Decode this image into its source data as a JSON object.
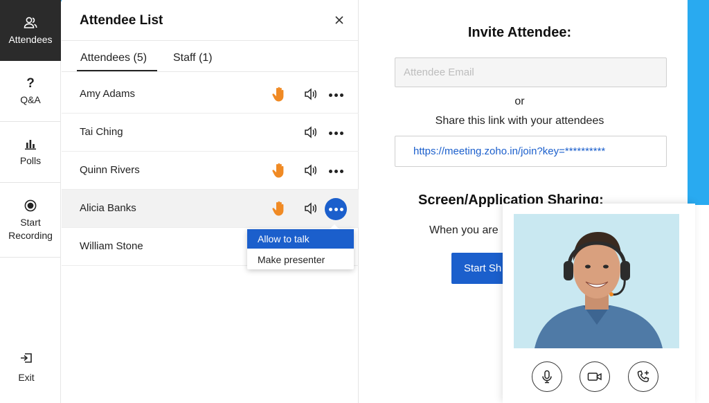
{
  "rail": {
    "items": [
      {
        "label": "Attendees",
        "icon": "people-icon",
        "active": true
      },
      {
        "label": "Q&A",
        "icon": "question-icon"
      },
      {
        "label": "Polls",
        "icon": "bar-chart-icon"
      },
      {
        "label": "Start Recording",
        "icon": "record-icon"
      }
    ],
    "exit_label": "Exit"
  },
  "attendee_panel": {
    "title": "Attendee List",
    "tabs": [
      {
        "label": "Attendees (5)",
        "active": true
      },
      {
        "label": "Staff (1)"
      }
    ],
    "rows": [
      {
        "name": "Amy Adams",
        "hand_raised": true
      },
      {
        "name": "Tai Ching",
        "hand_raised": false
      },
      {
        "name": "Quinn Rivers",
        "hand_raised": true
      },
      {
        "name": "Alicia Banks",
        "hand_raised": true,
        "menu_open": true
      },
      {
        "name": "William Stone",
        "hand_raised": false
      }
    ],
    "menu": {
      "items": [
        "Allow to talk",
        "Make presenter"
      ],
      "selected": "Allow to talk"
    }
  },
  "invite": {
    "title": "Invite Attendee:",
    "email_placeholder": "Attendee Email",
    "or_text": "or",
    "share_text": "Share this link with your attendees",
    "link": "https://meeting.zoho.in/join?key=**********",
    "screen_title": "Screen/Application Sharing:",
    "when_text": "When you are",
    "start_button": "Start Sh"
  },
  "colors": {
    "accent": "#1b5fcc",
    "hand": "#f08a24",
    "cyan": "#29aaf0",
    "active_rail": "#2b2b2b"
  }
}
